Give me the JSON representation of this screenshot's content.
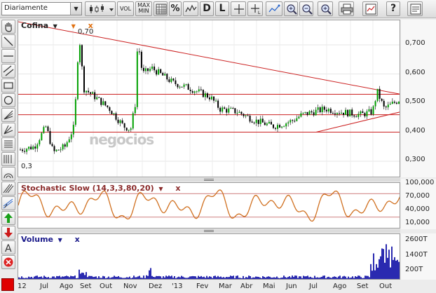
{
  "toolbar": {
    "period": "Diariamente",
    "vol_label": "VOL",
    "maxmin_label_1": "MAX",
    "maxmin_label_2": "MIN",
    "pct_label": "%",
    "d_label": "D",
    "l_label": "L",
    "help_label": "?"
  },
  "price_pane": {
    "title": "Cofina",
    "high_label": "0,70",
    "low_label": "0,3",
    "watermark": "negocios",
    "y_labels": [
      "0,700",
      "0,600",
      "0,500",
      "0,400",
      "0,300"
    ]
  },
  "stoch_pane": {
    "title": "Stochastic Slow (14,3,3,80,20)",
    "y_labels": [
      "100,000",
      "70,000",
      "40,000",
      "10,000"
    ]
  },
  "volume_pane": {
    "title": "Volume",
    "y_labels": [
      "2600T",
      "1400T",
      "200T"
    ]
  },
  "x_axis": {
    "labels": [
      "12",
      "Jul",
      "Ago",
      "Set",
      "Out",
      "Nov",
      "Dez",
      "'13",
      "Fev",
      "Mar",
      "Abr",
      "Mai",
      "Jun",
      "Jul",
      "Ago",
      "Set",
      "Out"
    ]
  },
  "colors": {
    "candle_up": "#00a000",
    "candle_down": "#000000",
    "trendline": "#cc2222",
    "stoch_line": "#d07020",
    "volume": "#2a2ab0"
  }
}
